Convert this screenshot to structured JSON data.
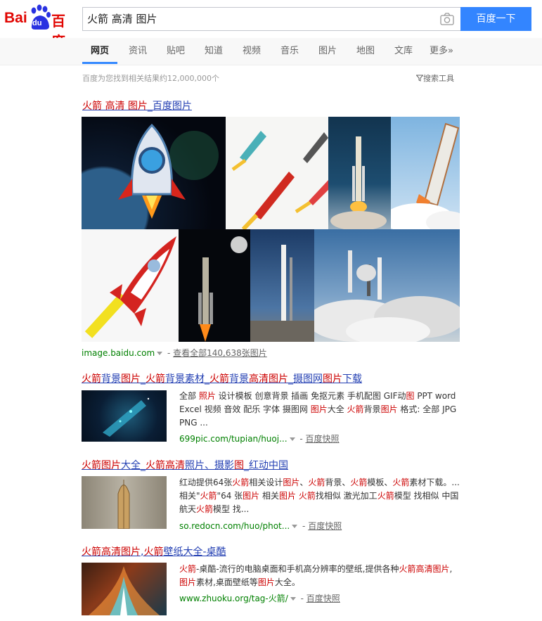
{
  "logo": {
    "text_bai": "Bai",
    "text_du": "du",
    "text_cn": "百度"
  },
  "search": {
    "query": "火箭 高清 图片",
    "button": "百度一下"
  },
  "nav": {
    "tabs": [
      "网页",
      "资讯",
      "贴吧",
      "知道",
      "视频",
      "音乐",
      "图片",
      "地图",
      "文库",
      "更多»"
    ],
    "active": "网页"
  },
  "stats": {
    "text": "百度为您找到相关结果约12,000,000个",
    "tools": "搜索工具"
  },
  "image_result": {
    "title_parts": [
      "火箭 高清 图片",
      "_百度图片"
    ],
    "source": "image.baidu.com",
    "view_all": "查看全部140,638张图片"
  },
  "results": [
    {
      "title": "火箭背景图片_火箭背景素材_火箭背景高清图片_摄图网图片下载",
      "snippet": "全部 照片 设计模板 创意背景 插画 免抠元素 手机配图 GIF动图 PPT word Excel 视频 音效 配乐 字体 摄图网 图片大全 火箭背景图片 格式: 全部 JPG PNG ...",
      "url": "699pic.com/tupian/huoj...",
      "cache": "百度快照"
    },
    {
      "title": "火箭图片大全_火箭高清照片、摄影图_红动中国",
      "snippet": "红动提供64张火箭相关设计图片、火箭背景、火箭模板、火箭素材下载。... 相关\"火箭\"64 张图片 相关图片 火箭找相似 激光加工火箭模型 找相似 中国航天火箭模型 找...",
      "url": "so.redocn.com/huo/phot...",
      "cache": "百度快照"
    },
    {
      "title": "火箭高清图片,火箭壁纸大全-桌酷",
      "snippet": "火箭-桌酷-流行的电脑桌面和手机高分辨率的壁纸,提供各种火箭高清图片,图片素材,桌面壁纸等图片大全。",
      "url": "www.zhuoku.org/tag-火箭/",
      "cache": "百度快照"
    }
  ],
  "colors": {
    "accent": "#3385ff",
    "link": "#2440b3",
    "highlight": "#cc0000",
    "url": "#008000"
  }
}
